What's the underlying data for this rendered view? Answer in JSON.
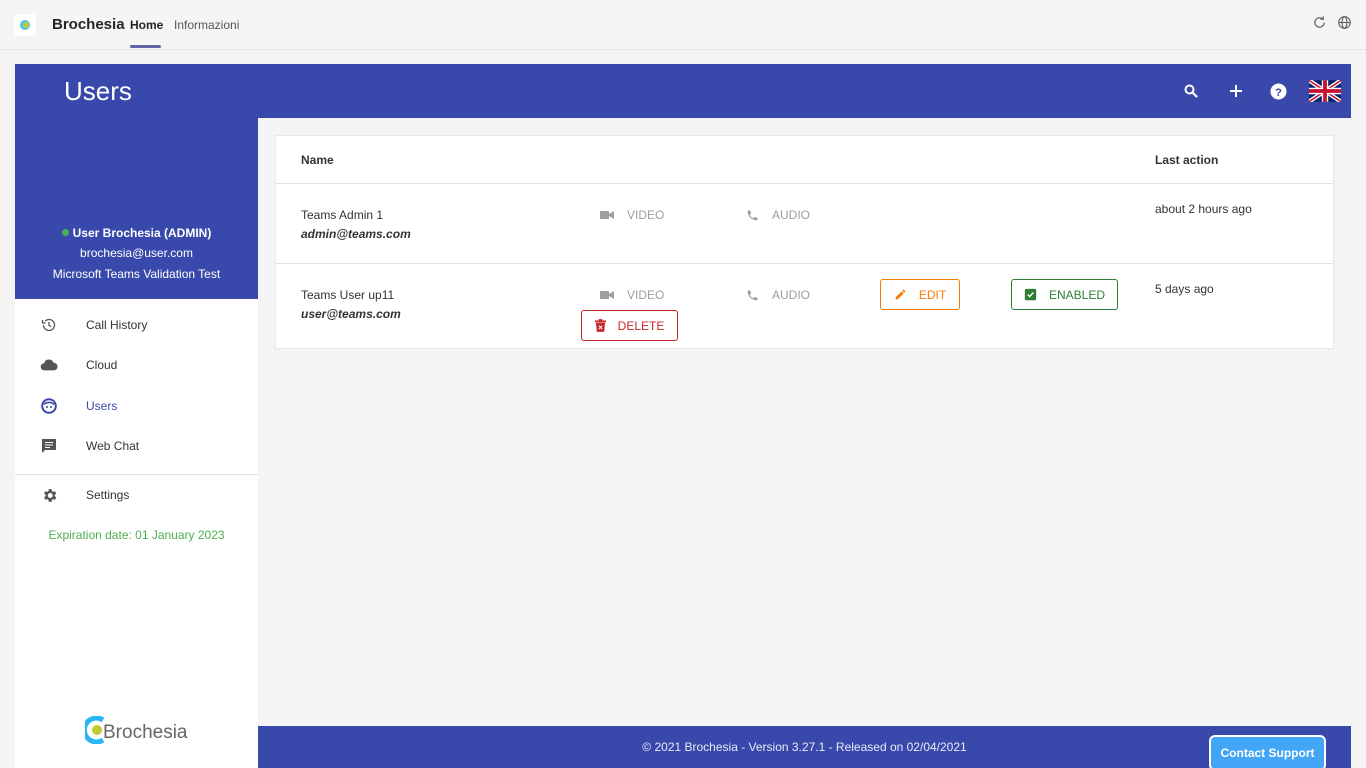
{
  "teams": {
    "app_name": "Brochesia",
    "tabs": [
      {
        "label": "Home",
        "active": true
      },
      {
        "label": "Informazioni",
        "active": false
      }
    ],
    "icons": [
      "refresh-icon",
      "globe-icon"
    ]
  },
  "header": {
    "title": "Users",
    "icons": [
      "search-icon",
      "plus-icon",
      "help-icon",
      "uk-flag-icon"
    ]
  },
  "profile": {
    "name": "User Brochesia (ADMIN)",
    "email": "brochesia@user.com",
    "organization": "Microsoft Teams Validation Test",
    "status_color": "#4caf50"
  },
  "nav": {
    "items": [
      {
        "label": "Call History",
        "icon": "history-icon",
        "active": false
      },
      {
        "label": "Cloud",
        "icon": "cloud-icon",
        "active": false
      },
      {
        "label": "Users",
        "icon": "face-icon",
        "active": true
      },
      {
        "label": "Web Chat",
        "icon": "chat-icon",
        "active": false
      }
    ],
    "settings": {
      "label": "Settings",
      "icon": "gear-icon"
    },
    "expiration": "Expiration date: 01 January 2023"
  },
  "logo": {
    "text": "Brochesia"
  },
  "table": {
    "columns": {
      "name": "Name",
      "last_action": "Last action"
    },
    "rows": [
      {
        "name": "Teams Admin 1",
        "email": "admin@teams.com",
        "video_label": "VIDEO",
        "audio_label": "AUDIO",
        "last_action": "about 2 hours ago"
      },
      {
        "name": "Teams User up11",
        "email": "user@teams.com",
        "video_label": "VIDEO",
        "audio_label": "AUDIO",
        "edit_label": "EDIT",
        "enabled_label": "ENABLED",
        "delete_label": "DELETE",
        "last_action": "5 days ago"
      }
    ]
  },
  "footer": {
    "text": "© 2021 Brochesia - Version 3.27.1 - Released on 02/04/2021",
    "support_label": "Contact Support"
  },
  "colors": {
    "primary": "#3949ab",
    "edit": "#f57c00",
    "enabled": "#2e7d32",
    "delete": "#c62828",
    "support": "#42a5f5",
    "expiration": "#4caf50"
  }
}
